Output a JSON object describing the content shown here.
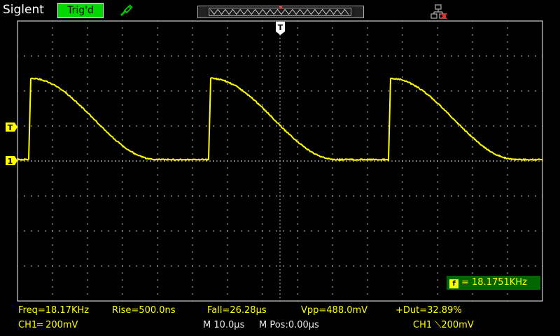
{
  "header": {
    "brand": "Siglent",
    "trigger_status": "Trig'd"
  },
  "freq_counter": {
    "icon": "f",
    "text": "= 18.1751KHz"
  },
  "measurements": [
    {
      "label": "Freq=18.17KHz"
    },
    {
      "label": "Rise=500.0ns"
    },
    {
      "label": "Fall=26.28µs"
    },
    {
      "label": "Vpp=488.0mV"
    },
    {
      "label": "+Dut=32.89%"
    }
  ],
  "footer": {
    "ch1_scale": "CH1═ 200mV",
    "timebase": "M 10.0µs",
    "mpos": "M Pos:0.00µs",
    "trigger_info": "CH1 ⟍200mV"
  },
  "markers": {
    "trigger_level": "T",
    "channel1": "1",
    "trigger_pos": "T"
  },
  "colors": {
    "trace": "#ffff00",
    "grid": "#c8c8c8",
    "status_ok": "#00d800",
    "counter_bg": "#006600"
  },
  "icons": {
    "probe": "probe-icon",
    "network": "network-disconnected-icon"
  }
}
